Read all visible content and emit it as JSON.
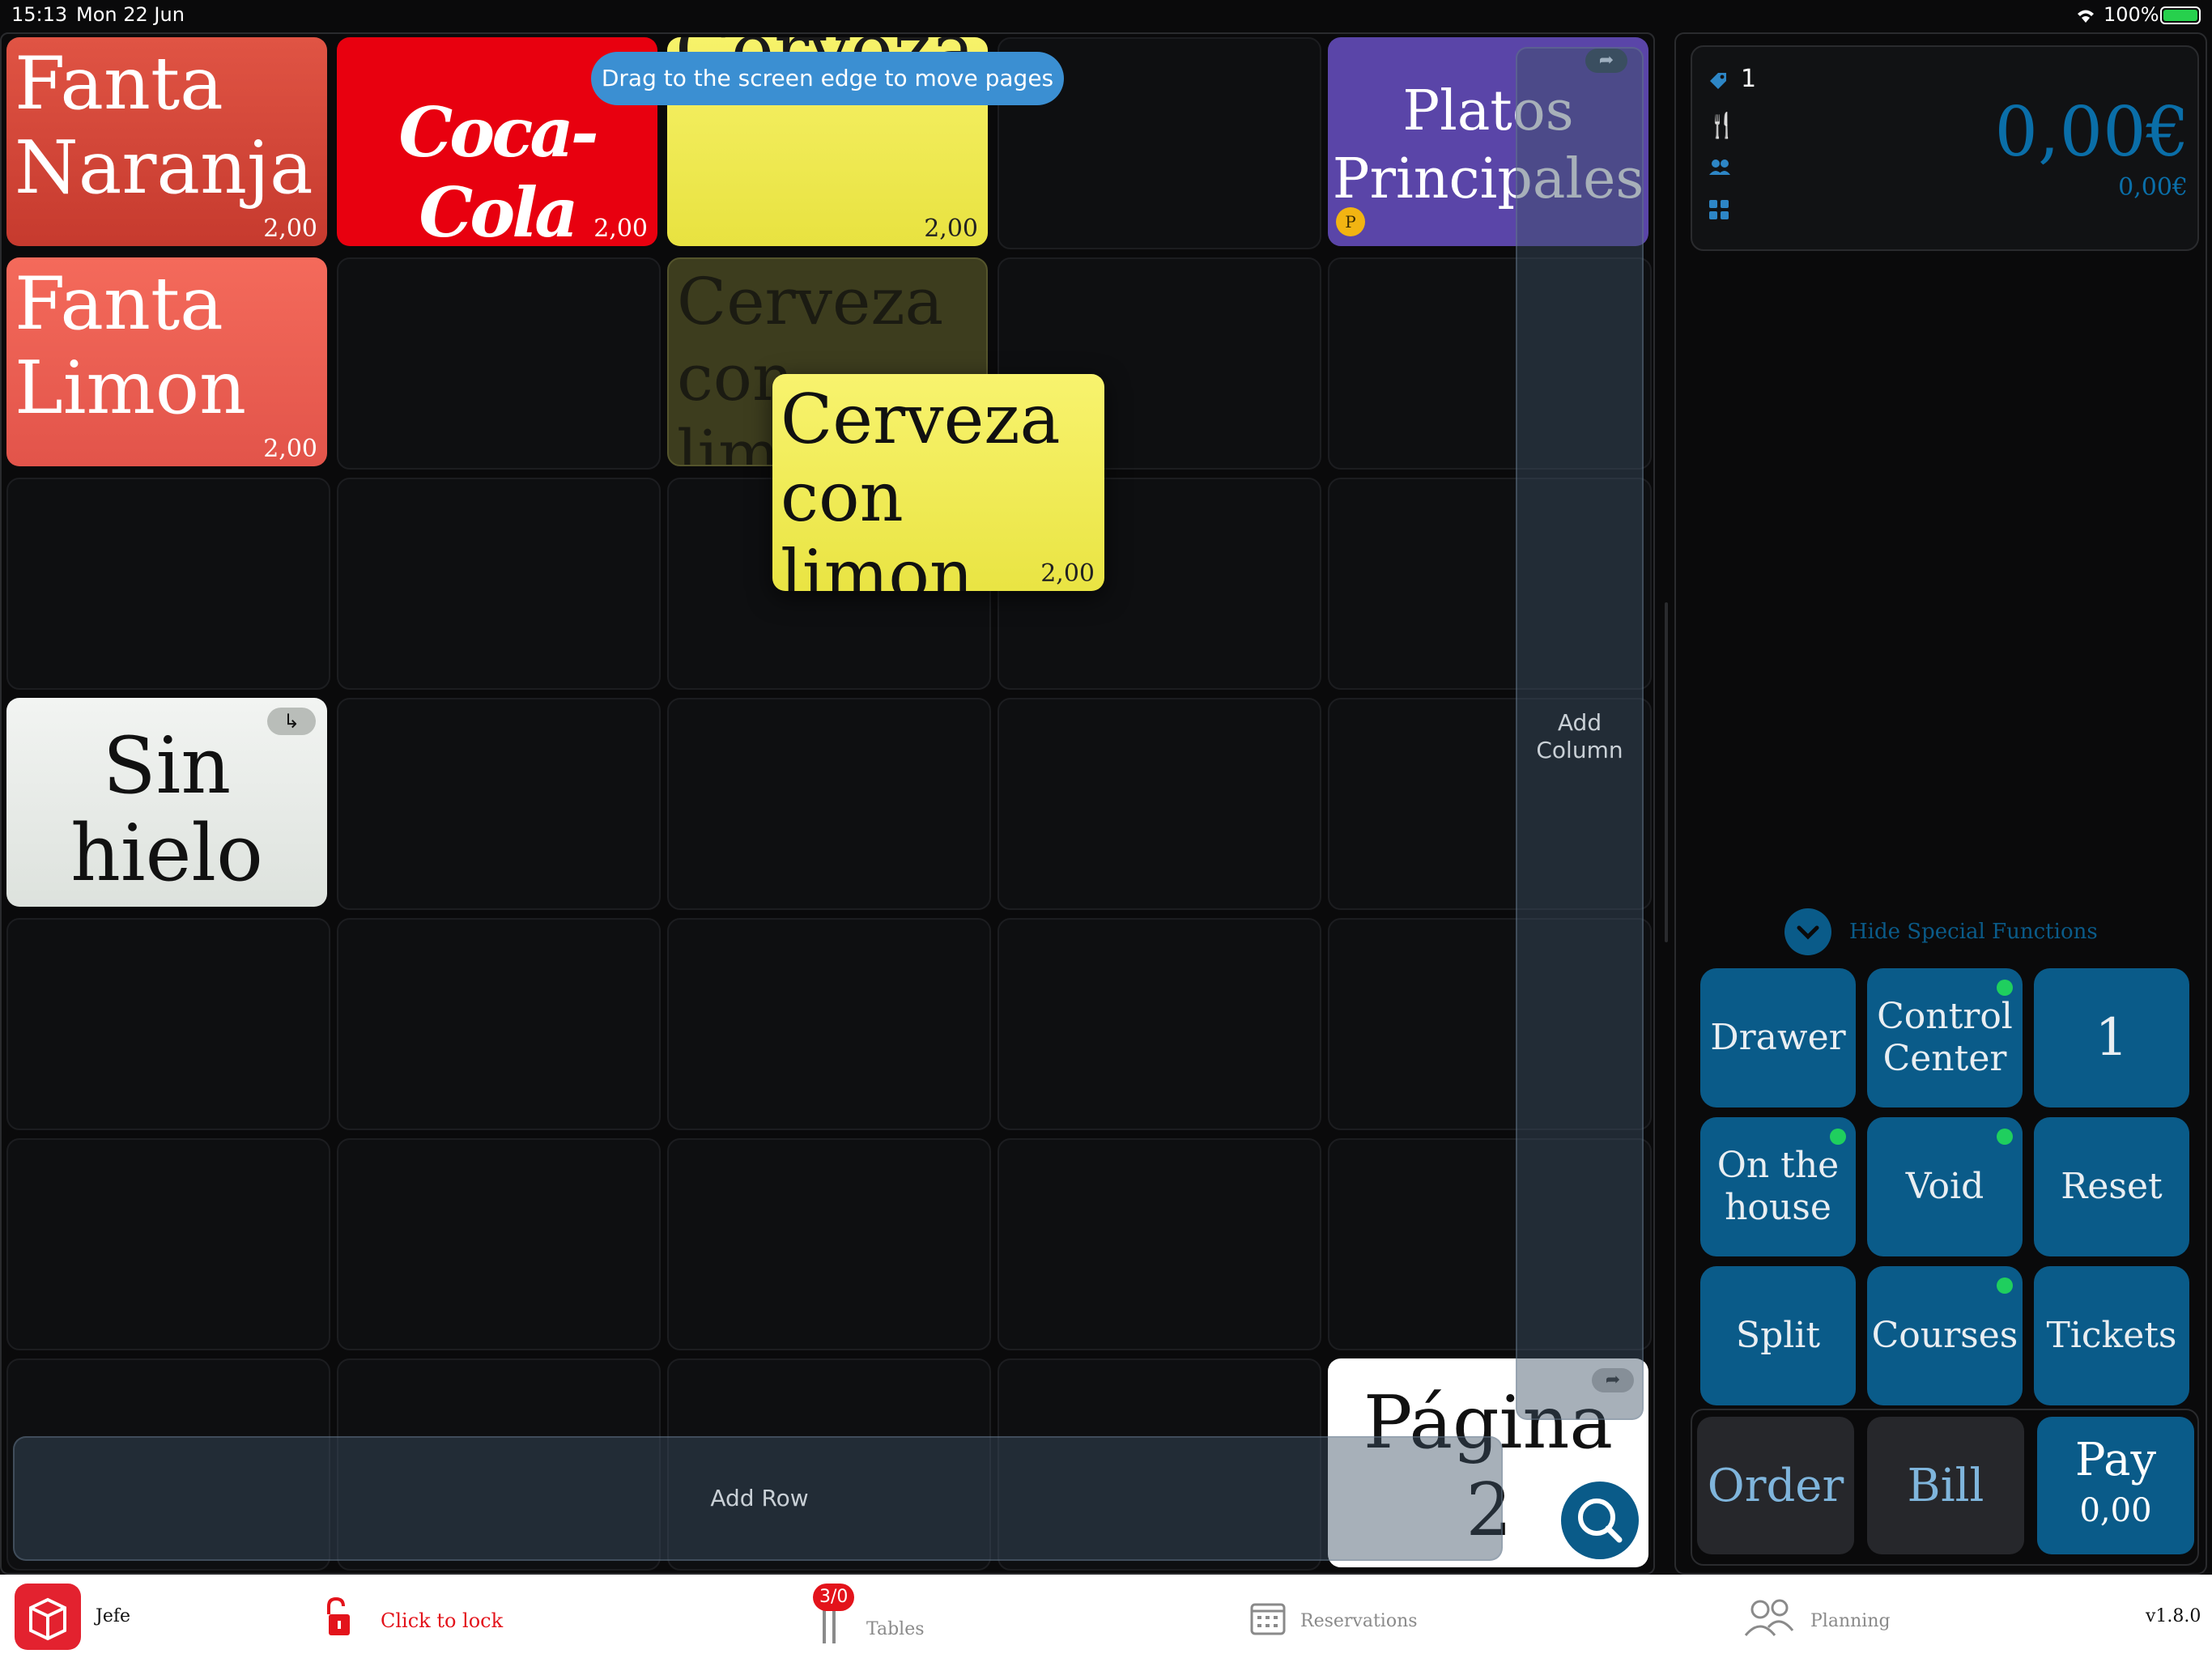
{
  "status_bar": {
    "time": "15:13",
    "date": "Mon 22 Jun",
    "battery": "100%"
  },
  "tooltip": "Drag to the screen edge to move pages",
  "products": {
    "fanta_naranja": {
      "line1": "Fanta",
      "line2": "Naranja",
      "price": "2,00"
    },
    "coca_cola": {
      "logo_text": "Coca-Cola",
      "price": "2,00"
    },
    "cerveza": {
      "line1": "Cerveza",
      "price": "2,00"
    },
    "platos_principales": {
      "line1": "Platos",
      "line2": "Principales",
      "badge": "P"
    },
    "fanta_limon": {
      "line1": "Fanta",
      "line2": "Limon",
      "price": "2,00"
    },
    "cerveza_con_limon_ghost": {
      "line1": "Cerveza",
      "line2": "con limon"
    },
    "cerveza_con_limon_drag": {
      "line1": "Cerveza",
      "line2": "con limon",
      "price": "2,00"
    },
    "sin_hielo": {
      "line1": "Sin",
      "line2": "hielo"
    },
    "pagina_2": {
      "line1": "Página",
      "line2": "2"
    }
  },
  "overlays": {
    "add_column": "Add\nColumn",
    "add_row": "Add Row"
  },
  "order_panel": {
    "item_count": "1",
    "total_large": "0,00€",
    "total_small": "0,00€",
    "hide_special_functions": "Hide Special Functions"
  },
  "functions": {
    "drawer": "Drawer",
    "control_center": "Control Center",
    "number": "1",
    "on_the_house": "On the house",
    "void": "Void",
    "reset": "Reset",
    "split": "Split",
    "courses": "Courses",
    "tickets": "Tickets"
  },
  "actions": {
    "order": "Order",
    "bill": "Bill",
    "pay": "Pay",
    "pay_amount": "0,00"
  },
  "tabbar": {
    "user": "Jefe",
    "lock": "Click to lock",
    "tables": "Tables",
    "tables_badge": "3/0",
    "reservations": "Reservations",
    "planning": "Planning",
    "version": "v1.8.0"
  },
  "colors": {
    "accent_blue": "#0a5b89",
    "fanta_naranja": "#d9493a",
    "coca_cola": "#e8000f",
    "cerveza": "#f6f05a",
    "platos": "#5a45a8",
    "fanta_limon": "#f06052",
    "lock_red": "#e3131b",
    "status_green": "#1fcf5e"
  }
}
